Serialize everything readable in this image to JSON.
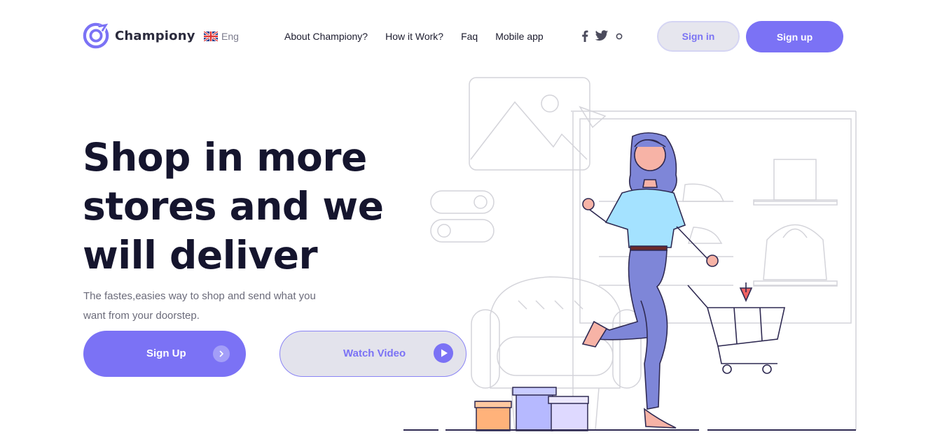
{
  "header": {
    "brand": "Championy",
    "language": "Eng",
    "nav": [
      "About Championy?",
      "How it Work?",
      "Faq",
      "Mobile app"
    ],
    "social_icons": [
      "facebook-icon",
      "twitter-icon",
      "instagram-icon"
    ],
    "signin_label": "Sign in",
    "signup_label": "Sign up"
  },
  "hero": {
    "headline": [
      "Shop in more",
      "stores and we",
      "will deliver"
    ],
    "subtitle": "The fastes,easies way to shop and send what you want from your doorstep.",
    "cta_primary": "Sign Up",
    "cta_secondary": "Watch Video"
  },
  "colors": {
    "accent": "#7b72f5",
    "accent_light": "#e3e3ec",
    "heading": "#15152e",
    "text_muted": "#6b6b7a"
  }
}
